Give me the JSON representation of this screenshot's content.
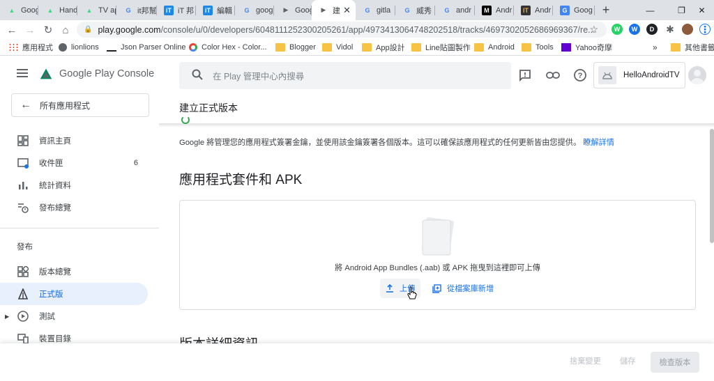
{
  "browser": {
    "tabs": [
      {
        "title": "Goog",
        "favicon": "android-icon"
      },
      {
        "title": "Hand",
        "favicon": "android-icon"
      },
      {
        "title": "TV ap",
        "favicon": "android-icon"
      },
      {
        "title": "it邦幫",
        "favicon": "google-icon"
      },
      {
        "title": "iT 邦",
        "favicon": "ithome-icon"
      },
      {
        "title": "編輯",
        "favicon": "ithome-icon"
      },
      {
        "title": "goog",
        "favicon": "google-icon"
      },
      {
        "title": "Goog",
        "favicon": "play-icon"
      },
      {
        "title": "建",
        "favicon": "play-icon",
        "active": true
      },
      {
        "title": "gitla",
        "favicon": "google-icon"
      },
      {
        "title": "威秀",
        "favicon": "google-icon"
      },
      {
        "title": "andr",
        "favicon": "google-icon"
      },
      {
        "title": "Andr",
        "favicon": "medium-icon"
      },
      {
        "title": "Andr",
        "favicon": "it-icon"
      },
      {
        "title": "Goog",
        "favicon": "translate-icon"
      }
    ],
    "url_host": "play.google.com",
    "url_path": "/console/u/0/developers/6048111252300205261/app/4973413064748202518/tracks/4697302052686969367/re...",
    "bookmarks": [
      {
        "label": "應用程式",
        "icon": "apps-grid-icon"
      },
      {
        "label": "lionlions",
        "icon": "globe-icon"
      },
      {
        "label": "Json Parser Online",
        "icon": "json-icon"
      },
      {
        "label": "Color Hex - Color...",
        "icon": "colorhex-icon"
      },
      {
        "label": "Blogger",
        "icon": "folder-icon"
      },
      {
        "label": "Vidol",
        "icon": "folder-icon"
      },
      {
        "label": "App設計",
        "icon": "folder-icon"
      },
      {
        "label": "Line貼圖製作",
        "icon": "folder-icon"
      },
      {
        "label": "Android",
        "icon": "folder-icon"
      },
      {
        "label": "Tools",
        "icon": "folder-icon"
      },
      {
        "label": "Yahoo奇摩",
        "icon": "yahoo-icon"
      }
    ],
    "bookmarks_overflow": "»",
    "other_bookmarks": "其他書籤"
  },
  "console": {
    "brand": "Google Play Console",
    "all_apps": "所有應用程式",
    "nav": [
      {
        "label": "資訊主頁",
        "icon": "dashboard-icon"
      },
      {
        "label": "收件匣",
        "icon": "inbox-icon",
        "badge": "6"
      },
      {
        "label": "統計資料",
        "icon": "bar-chart-icon"
      },
      {
        "label": "發布總覽",
        "icon": "publishing-overview-icon"
      }
    ],
    "section_label": "發布",
    "nav2": [
      {
        "label": "版本總覽",
        "icon": "releases-overview-icon"
      },
      {
        "label": "正式版",
        "icon": "production-icon",
        "active": true
      },
      {
        "label": "測試",
        "icon": "testing-icon"
      },
      {
        "label": "裝置目錄",
        "icon": "device-catalog-icon"
      }
    ],
    "search_placeholder": "在 Play 管理中心內搜尋",
    "app_name": "HelloAndroidTV",
    "page_title": "建立正式版本",
    "signing_info": "Google 將管理您的應用程式簽署金鑰，並使用該金鑰簽署各個版本。這可以確保該應用程式的任何更新皆由您提供。",
    "learn_more": "瞭解詳情",
    "bundles_title": "應用程式套件和 APK",
    "drop_text": "將 Android App Bundles (.aab) 或 APK 拖曳到這裡即可上傳",
    "upload_label": "上傳",
    "add_from_library": "從檔案庫新增",
    "release_details_title": "版本詳細資訊",
    "footer": {
      "discard": "捨棄變更",
      "save": "儲存",
      "review": "檢查版本"
    }
  },
  "colors": {
    "accent": "#1a73e8",
    "active_nav_bg": "#e8f0fe",
    "chrome_tabstrip": "#dee1e6"
  }
}
